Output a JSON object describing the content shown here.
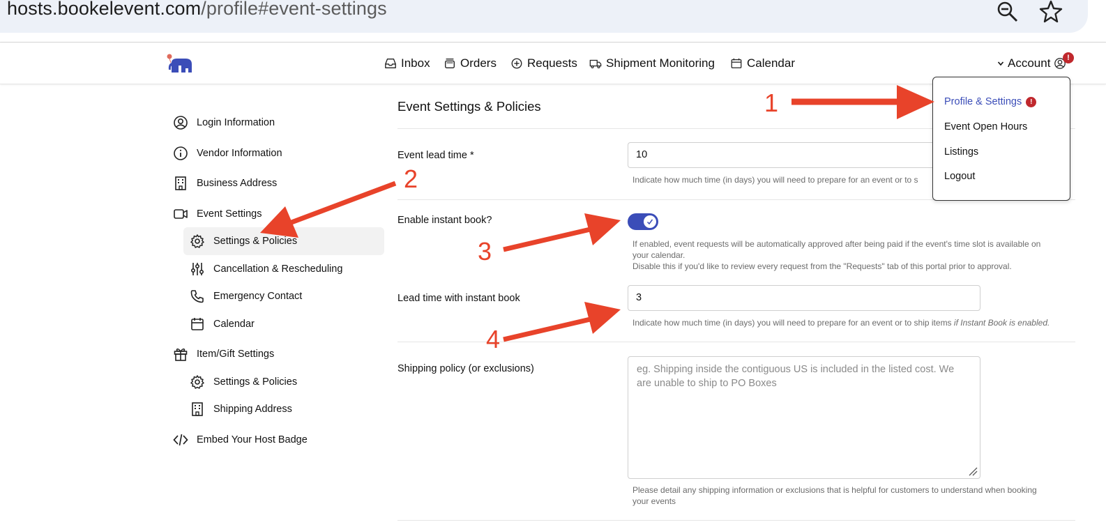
{
  "browser": {
    "url_host": "hosts.bookelevent.com",
    "url_path": "/profile#event-settings"
  },
  "nav": {
    "items": [
      {
        "label": "Inbox",
        "icon": "inbox-icon"
      },
      {
        "label": "Orders",
        "icon": "orders-icon"
      },
      {
        "label": "Requests",
        "icon": "plus-circle-icon"
      },
      {
        "label": "Shipment Monitoring",
        "icon": "truck-icon"
      },
      {
        "label": "Calendar",
        "icon": "calendar-icon"
      }
    ],
    "account_label": "Account",
    "account_badge": "!"
  },
  "dropdown": {
    "items": [
      {
        "label": "Profile & Settings",
        "active": true,
        "badge": "!"
      },
      {
        "label": "Event Open Hours"
      },
      {
        "label": "Listings"
      },
      {
        "label": "Logout"
      }
    ]
  },
  "sidebar": {
    "items": [
      {
        "label": "Login Information",
        "icon": "user-circle-icon"
      },
      {
        "label": "Vendor Information",
        "icon": "info-icon"
      },
      {
        "label": "Business Address",
        "icon": "building-icon"
      },
      {
        "label": "Event Settings",
        "icon": "video-icon"
      },
      {
        "label": "Settings & Policies",
        "icon": "gear-icon",
        "active": true
      },
      {
        "label": "Cancellation & Rescheduling",
        "icon": "sliders-icon"
      },
      {
        "label": "Emergency Contact",
        "icon": "phone-icon"
      },
      {
        "label": "Calendar",
        "icon": "calendar-icon"
      },
      {
        "label": "Item/Gift Settings",
        "icon": "gift-icon"
      },
      {
        "label": "Settings & Policies",
        "icon": "gear-icon"
      },
      {
        "label": "Shipping Address",
        "icon": "building-icon"
      },
      {
        "label": "Embed Your Host Badge",
        "icon": "code-icon"
      }
    ]
  },
  "main": {
    "title": "Event Settings & Policies",
    "lead_time": {
      "label": "Event lead time *",
      "value": "10",
      "help": "Indicate how much time (in days) you will need to prepare for an event or to s"
    },
    "instant_book": {
      "label": "Enable instant book?",
      "enabled": true,
      "help_line1": "If enabled, event requests will be automatically approved after being paid if the event's time slot is available on",
      "help_line2": "your calendar.",
      "help_line3": "Disable this if you'd like to review every request from the \"Requests\" tab of this portal prior to approval."
    },
    "instant_lead": {
      "label": "Lead time with instant book",
      "value": "3",
      "help": "Indicate how much time (in days) you will need to prepare for an event or to ship items ",
      "help_em": "if Instant Book is enabled."
    },
    "shipping": {
      "label": "Shipping policy (or exclusions)",
      "placeholder": "eg. Shipping inside the contiguous US is included in the listed cost. We are unable to ship to PO Boxes",
      "help_line1": "Please detail any shipping information or exclusions that is helpful for customers to understand when booking",
      "help_line2": "your events"
    }
  },
  "annotations": {
    "labels": [
      "1",
      "2",
      "3",
      "4"
    ],
    "color": "#e8432a"
  },
  "colors": {
    "accent": "#3b4db8",
    "alert": "#c0282d"
  }
}
